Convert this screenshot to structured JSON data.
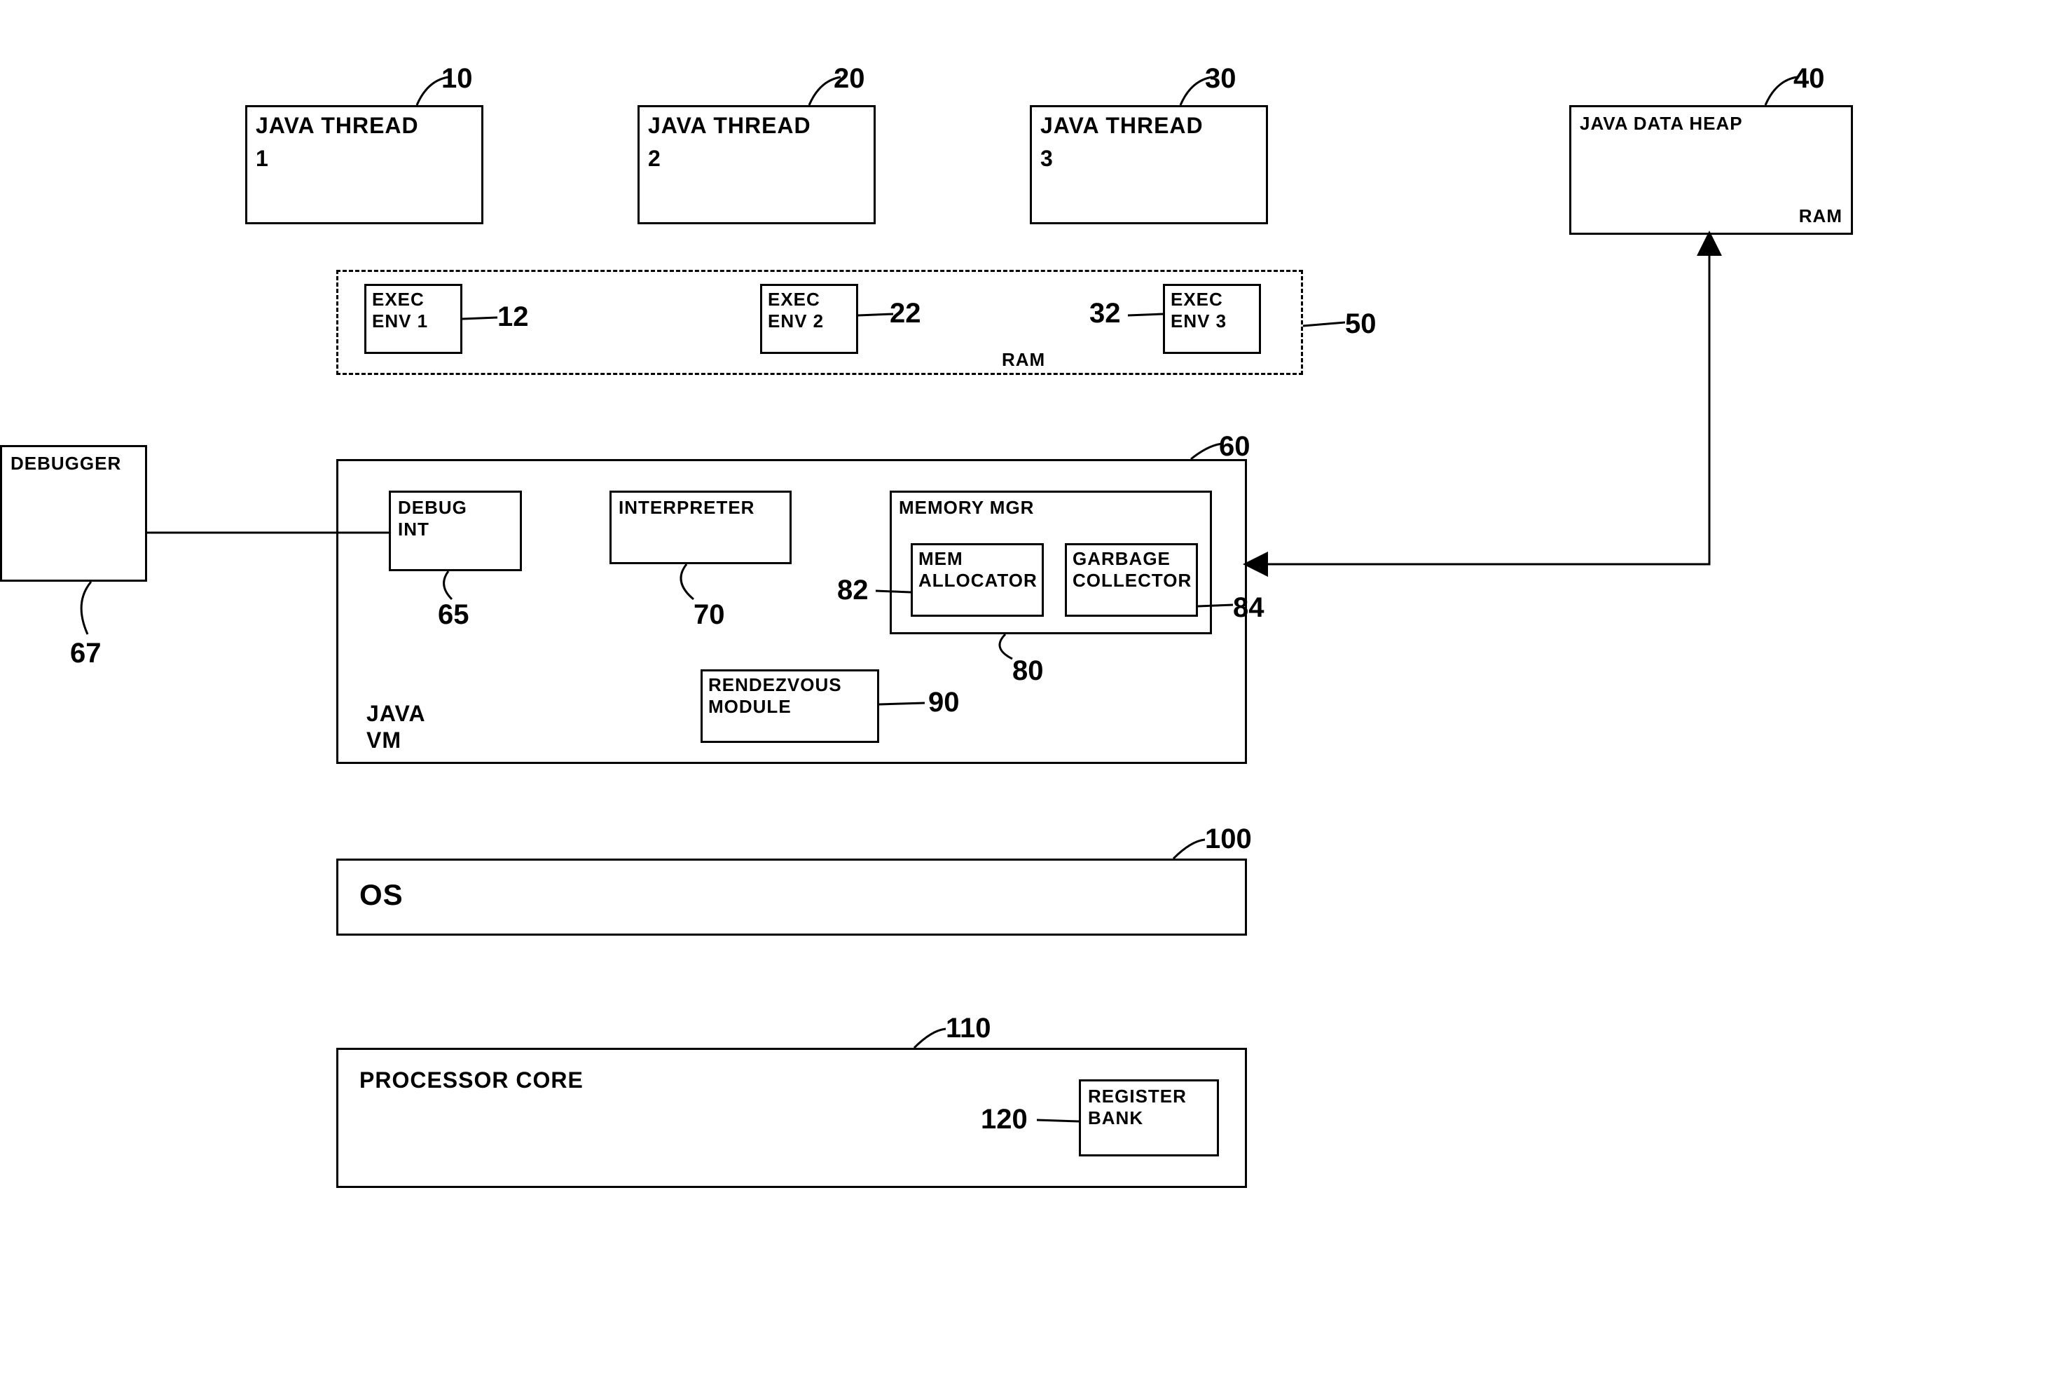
{
  "threads": {
    "t1": {
      "line1": "JAVA THREAD",
      "line2": "1",
      "ref": "10"
    },
    "t2": {
      "line1": "JAVA THREAD",
      "line2": "2",
      "ref": "20"
    },
    "t3": {
      "line1": "JAVA THREAD",
      "line2": "3",
      "ref": "30"
    }
  },
  "heap": {
    "line1": "JAVA DATA HEAP",
    "corner": "RAM",
    "ref": "40"
  },
  "envs": {
    "e1": {
      "line1": "EXEC",
      "line2": "ENV 1",
      "ref": "12"
    },
    "e2": {
      "line1": "EXEC",
      "line2": "ENV 2",
      "ref": "22"
    },
    "e3": {
      "line1": "EXEC",
      "line2": "ENV 3",
      "ref": "32"
    },
    "ram": "RAM",
    "ref": "50"
  },
  "debugger": {
    "label": "DEBUGGER",
    "ref": "67"
  },
  "vm": {
    "label1": "JAVA",
    "label2": "VM",
    "ref": "60",
    "debugint": {
      "line1": "DEBUG",
      "line2": "INT",
      "ref": "65"
    },
    "interpreter": {
      "label": "INTERPRETER",
      "ref": "70"
    },
    "memmgr": {
      "label": "MEMORY MGR",
      "ref": "80",
      "alloc": {
        "line1": "MEM",
        "line2": "ALLOCATOR",
        "ref": "82"
      },
      "gc": {
        "line1": "GARBAGE",
        "line2": "COLLECTOR",
        "ref": "84"
      }
    },
    "rendezvous": {
      "line1": "RENDEZVOUS",
      "line2": "MODULE",
      "ref": "90"
    }
  },
  "os": {
    "label": "OS",
    "ref": "100"
  },
  "core": {
    "label": "PROCESSOR CORE",
    "ref": "110",
    "register": {
      "line1": "REGISTER",
      "line2": "BANK",
      "ref": "120"
    }
  }
}
